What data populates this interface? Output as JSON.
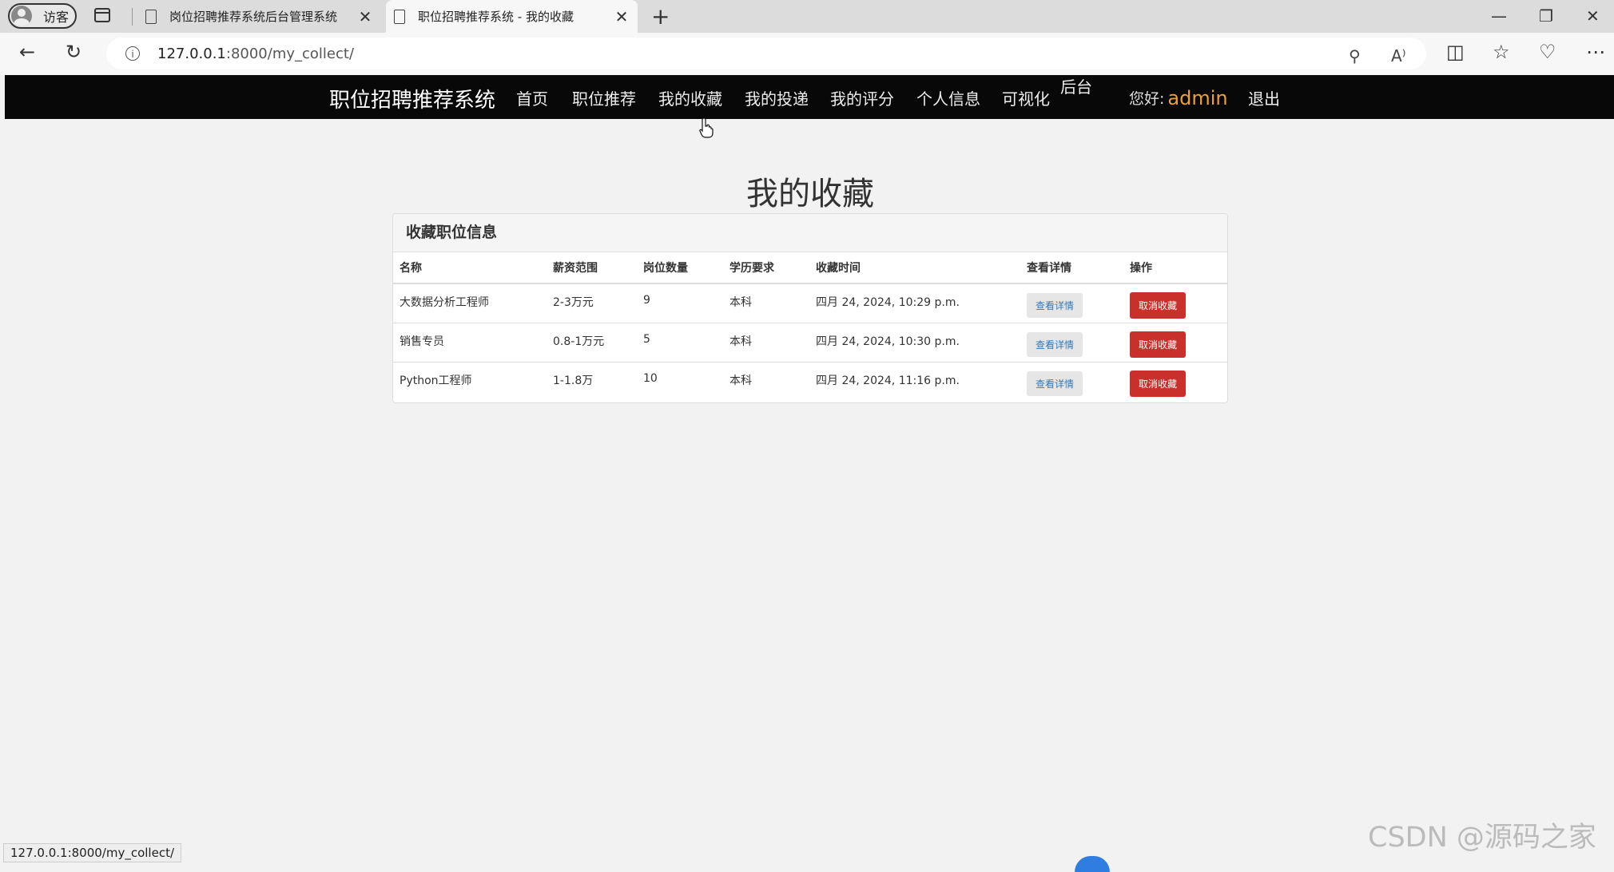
{
  "browser": {
    "profile_label": "访客",
    "tabs": [
      {
        "title": "岗位招聘推荐系统后台管理系统",
        "active": false
      },
      {
        "title": "职位招聘推荐系统 - 我的收藏",
        "active": true
      }
    ],
    "url_host": "127.0.0.1",
    "url_path": ":8000/my_collect/",
    "status_url": "127.0.0.1:8000/my_collect/"
  },
  "site": {
    "brand": "职位招聘推荐系统",
    "nav": {
      "home": "首页",
      "recommend": "职位推荐",
      "collect": "我的收藏",
      "deliver": "我的投递",
      "rating": "我的评分",
      "profile": "个人信息",
      "visual": "可视化",
      "admin": "后台"
    },
    "greeting": "您好:",
    "username": "admin",
    "logout": "退出"
  },
  "main": {
    "title": "我的收藏",
    "panel_title": "收藏职位信息",
    "columns": [
      "名称",
      "薪资范围",
      "岗位数量",
      "学历要求",
      "收藏时间",
      "查看详情",
      "操作"
    ],
    "rows": [
      {
        "name": "大数据分析工程师",
        "salary": "2-3万元",
        "count": "9",
        "education": "本科",
        "time": "四月 24, 2024, 10:29 p.m.",
        "detail": "查看详情",
        "action": "取消收藏"
      },
      {
        "name": "销售专员",
        "salary": "0.8-1万元",
        "count": "5",
        "education": "本科",
        "time": "四月 24, 2024, 10:30 p.m.",
        "detail": "查看详情",
        "action": "取消收藏"
      },
      {
        "name": "Python工程师",
        "salary": "1-1.8万",
        "count": "10",
        "education": "本科",
        "time": "四月 24, 2024, 11:16 p.m.",
        "detail": "查看详情",
        "action": "取消收藏"
      }
    ]
  },
  "watermark": "CSDN @源码之家",
  "colors": {
    "navbar": "#080808",
    "username": "#f0a030",
    "danger": "#c9302c",
    "link": "#337ab7"
  }
}
